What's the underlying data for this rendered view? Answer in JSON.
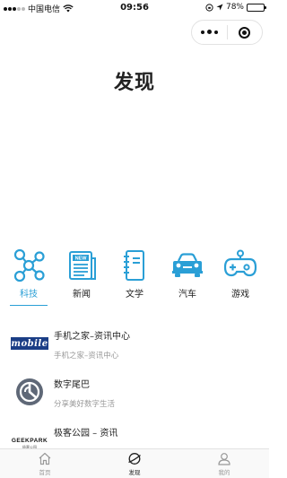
{
  "status_bar": {
    "carrier": "中国电信",
    "time": "09:56",
    "battery_text": "78%",
    "battery_level": 0.78
  },
  "page": {
    "title": "发现"
  },
  "categories": [
    {
      "label": "科技",
      "icon": "network-nodes-icon",
      "active": true
    },
    {
      "label": "新闻",
      "icon": "newspaper-icon",
      "active": false
    },
    {
      "label": "文学",
      "icon": "notebook-icon",
      "active": false
    },
    {
      "label": "汽车",
      "icon": "car-icon",
      "active": false
    },
    {
      "label": "游戏",
      "icon": "gamepad-icon",
      "active": false
    }
  ],
  "list": [
    {
      "title": "手机之家–资讯中心",
      "subtitle": "手机之家–资讯中心",
      "logo": "mobile-logo",
      "logo_text": "mobile"
    },
    {
      "title": "数字尾巴",
      "subtitle": "分享美好数字生活",
      "logo": "dgtle-logo"
    },
    {
      "title": "极客公园 – 资讯",
      "subtitle": "",
      "logo": "geekpark-logo",
      "logo_text": "GEEKPARK",
      "logo_subtext": "极客公园"
    }
  ],
  "tabbar": [
    {
      "label": "首页",
      "icon": "home-icon",
      "active": false
    },
    {
      "label": "发现",
      "icon": "compass-planet-icon",
      "active": true
    },
    {
      "label": "我的",
      "icon": "person-icon",
      "active": false
    }
  ],
  "colors": {
    "accent": "#2a9fd6",
    "text": "#222222",
    "muted": "#999999"
  }
}
